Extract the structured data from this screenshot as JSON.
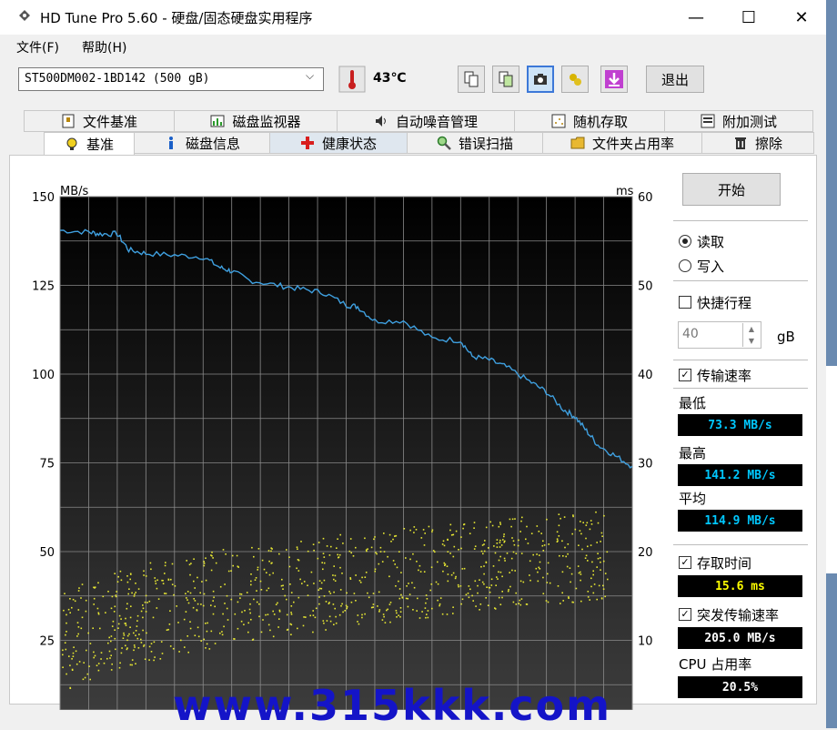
{
  "window": {
    "title": "HD Tune Pro 5.60 - 硬盘/固态硬盘实用程序",
    "minimize": "—",
    "maximize": "☐",
    "close": "✕"
  },
  "menu": {
    "items": [
      "文件(F)",
      "帮助(H)"
    ]
  },
  "toolbar": {
    "drive": "ST500DM002-1BD142 (500 gB)",
    "temperature": "43℃",
    "exit_label": "退出"
  },
  "tabs_top": [
    "文件基准",
    "磁盘监视器",
    "自动噪音管理",
    "随机存取",
    "附加测试"
  ],
  "tabs_bottom": [
    "基准",
    "磁盘信息",
    "健康状态",
    "错误扫描",
    "文件夹占用率",
    "擦除"
  ],
  "right_panel": {
    "start_label": "开始",
    "read_label": "读取",
    "write_label": "写入",
    "short_stroke_label": "快捷行程",
    "short_stroke_value": "40",
    "short_stroke_unit": "gB",
    "transfer_rate_label": "传输速率",
    "min_label": "最低",
    "min_value": "73.3 MB/s",
    "max_label": "最高",
    "max_value": "141.2 MB/s",
    "avg_label": "平均",
    "avg_value": "114.9 MB/s",
    "access_time_label": "存取时间",
    "access_time_value": "15.6 ms",
    "burst_label": "突发传输速率",
    "burst_value": "205.0 MB/s",
    "cpu_label": "CPU 占用率",
    "cpu_value": "20.5%"
  },
  "watermark": "www.315kkk.com",
  "colors": {
    "plot_bg_top": "#000000",
    "plot_bg_bottom": "#3c3c3c",
    "line": "#3fa0e0",
    "scatter": "#e8e832",
    "cyan_text": "#00c8ff",
    "yellow_text": "#ffff00",
    "white_text": "#ffffff"
  },
  "chart_data": {
    "type": "line",
    "left_axis_unit": "MB/s",
    "right_axis_unit": "ms",
    "ylim_left": [
      0,
      150
    ],
    "ylim_right": [
      0,
      60
    ],
    "left_ticks": [
      "150",
      "125",
      "100",
      "75",
      "50",
      "25"
    ],
    "right_ticks": [
      "60",
      "50",
      "40",
      "30",
      "20",
      "10"
    ],
    "grid": true,
    "series": [
      {
        "axis": "left",
        "x": [
          0,
          0.05,
          0.07,
          0.1,
          0.12,
          0.15,
          0.2,
          0.25,
          0.28,
          0.3,
          0.33,
          0.38,
          0.42,
          0.46,
          0.5,
          0.52,
          0.55,
          0.6,
          0.65,
          0.7,
          0.72,
          0.75,
          0.78,
          0.82,
          0.85,
          0.88,
          0.9,
          0.92,
          0.94,
          0.97,
          1.0
        ],
        "values": [
          140.5,
          140,
          139.5,
          139.5,
          135,
          134,
          133.5,
          133,
          130,
          129,
          126.5,
          125,
          124,
          123,
          119.5,
          119,
          115,
          115,
          110,
          109.5,
          105,
          104,
          102,
          98,
          95,
          90,
          88,
          84,
          80,
          77,
          74
        ]
      },
      {
        "axis": "right",
        "kind": "scatter",
        "range_ms_at_start": [
          3,
          15
        ],
        "range_ms_at_end": [
          15,
          25
        ]
      }
    ]
  }
}
